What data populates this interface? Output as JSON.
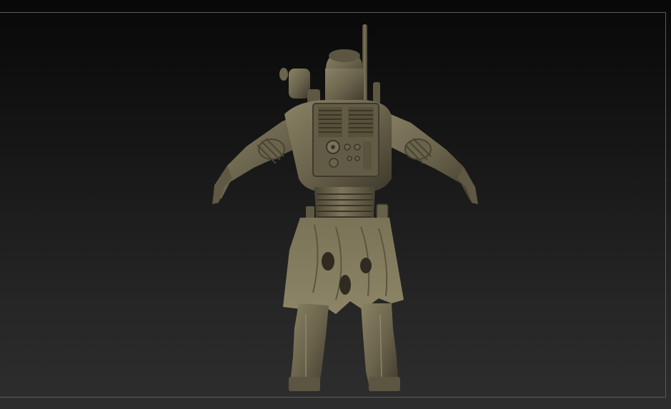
{
  "app": {
    "mode": "sculpt-viewport"
  },
  "viewport": {
    "background_top": "#080808",
    "background_bottom": "#2e2e2e",
    "frame_color": "#5a5a5a"
  },
  "model": {
    "material_color": "#6e6750",
    "shadow_color": "#2f2b20",
    "highlight_color": "#8c8466",
    "view": "back"
  }
}
